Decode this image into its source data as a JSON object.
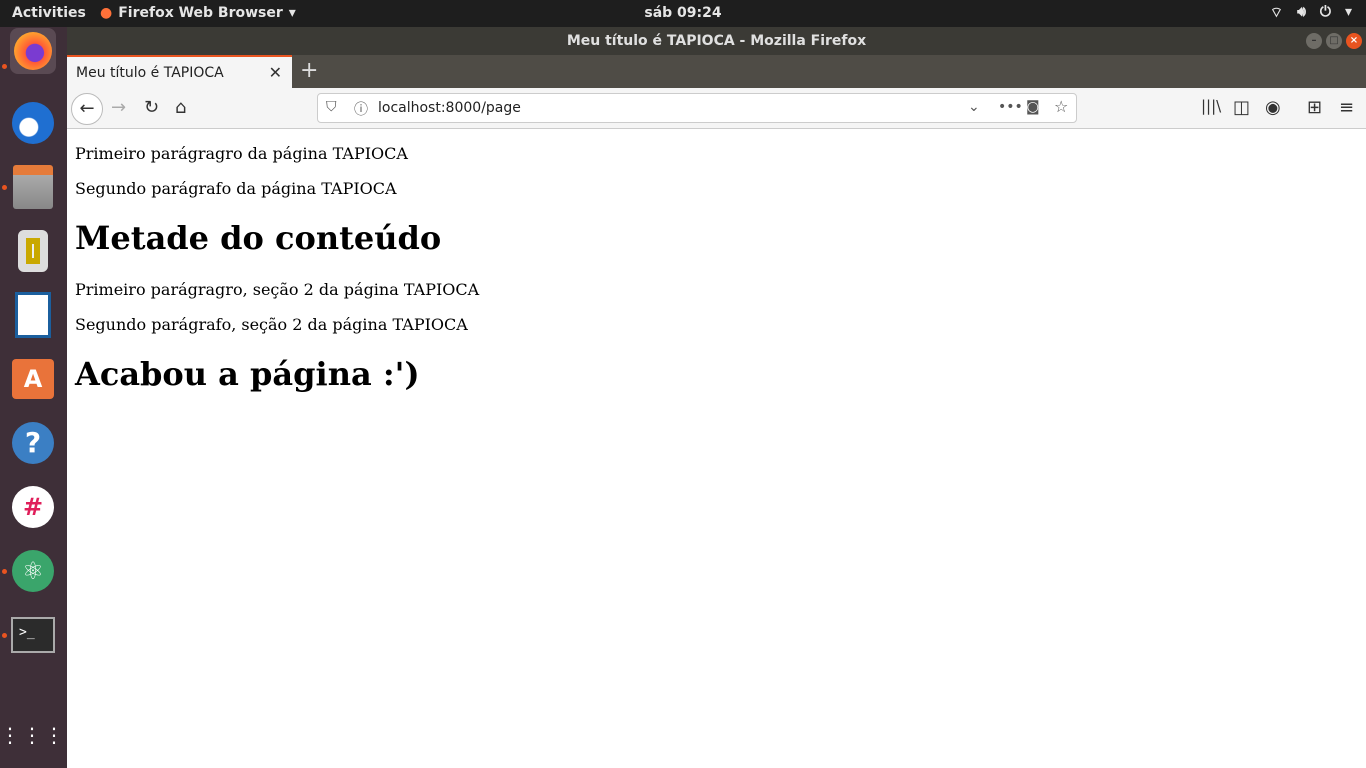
{
  "topbar": {
    "activities": "Activities",
    "app_menu": "Firefox Web Browser",
    "clock": "sáb 09:24"
  },
  "window": {
    "title": "Meu título é TAPIOCA - Mozilla Firefox"
  },
  "tab": {
    "label": "Meu título é TAPIOCA"
  },
  "nav": {
    "url": "localhost:8000/page"
  },
  "page": {
    "p1": "Primeiro parágragro da página TAPIOCA",
    "p2": "Segundo parágrafo da página TAPIOCA",
    "h1": "Metade do conteúdo",
    "p3": "Primeiro parágragro, seção 2 da página TAPIOCA",
    "p4": "Segundo parágrafo, seção 2 da página TAPIOCA",
    "h2": "Acabou a página :')"
  },
  "dock": [
    "firefox",
    "thunderbird",
    "files",
    "rhythmbox",
    "libreoffice-writer",
    "software",
    "help",
    "slack",
    "atom",
    "terminal",
    "show-apps"
  ],
  "colors": {
    "accent": "#e95420"
  }
}
